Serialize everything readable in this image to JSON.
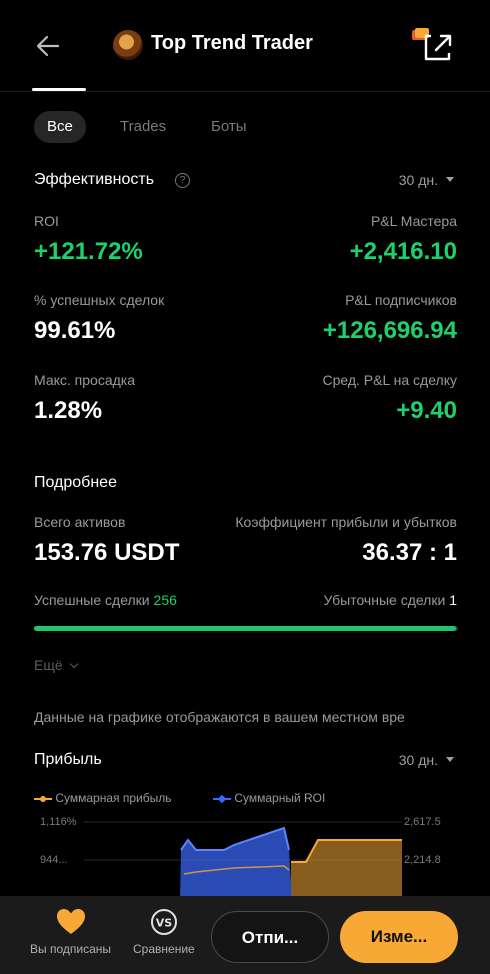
{
  "header": {
    "title": "Top Trend Trader",
    "back_icon": "arrow-left-icon",
    "share_icon": "share-external-icon"
  },
  "tabs": [
    {
      "label": "Все",
      "active": true
    },
    {
      "label": "Trades",
      "active": false
    },
    {
      "label": "Боты",
      "active": false
    }
  ],
  "performance": {
    "title": "Эффективность",
    "period": "30 дн.",
    "roi_label": "ROI",
    "roi_value": "+121.72%",
    "master_pnl_label": "P&L Мастера",
    "master_pnl_value": "+2,416.10",
    "win_rate_label": "% успешных сделок",
    "win_rate_value": "99.61%",
    "subscribers_pnl_label": "P&L подписчиков",
    "subscribers_pnl_value": "+126,696.94",
    "max_drawdown_label": "Макс. просадка",
    "max_drawdown_value": "1.28%",
    "avg_pnl_label": "Сред. P&L на сделку",
    "avg_pnl_value": "+9.40"
  },
  "details": {
    "title": "Подробнее",
    "total_assets_label": "Всего активов",
    "total_assets_value": "153.76 USDT",
    "profit_factor_label": "Коэффициент прибыли и убытков",
    "profit_factor_value": "36.37 : 1",
    "win_trades_label": "Успешные сделки",
    "win_trades_value": "256",
    "loss_trades_label": "Убыточные сделки",
    "loss_trades_value": "1",
    "win_ratio": 0.9961,
    "more_label": "Ещё",
    "note": "Данные на графике отображаются в вашем местном вре"
  },
  "profit": {
    "title": "Прибыль",
    "period": "30 дн.",
    "legend_profit": "Суммарная прибыль",
    "legend_roi": "Суммарный ROI",
    "y_left": [
      "1,116%",
      "944..."
    ],
    "y_right": [
      "2,617.5",
      "2,214.8"
    ],
    "colors": {
      "profit": "#f7a835",
      "roi": "#3a6bff"
    }
  },
  "bottom_bar": {
    "subscribed_label": "Вы подписаны",
    "compare_label": "Сравнение",
    "outline_button": "Отпи...",
    "primary_button": "Изме..."
  }
}
